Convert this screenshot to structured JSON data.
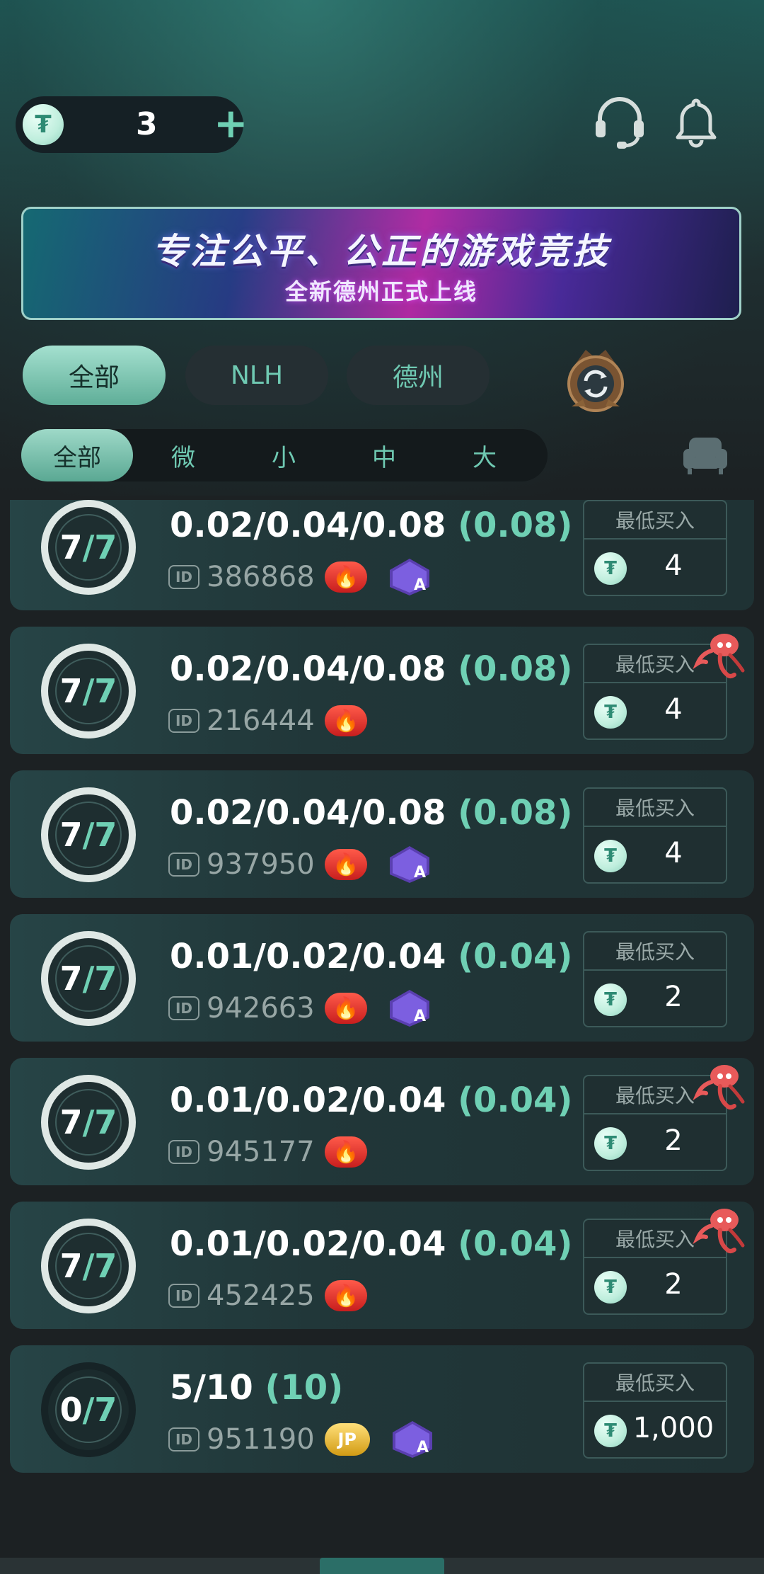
{
  "header": {
    "balance": "3",
    "currency_icon": "tether-coin-icon",
    "add_icon": "plus-icon",
    "support_icon": "headset-icon",
    "notify_icon": "bell-icon"
  },
  "banner": {
    "title": "专注公平、公正的游戏竞技",
    "subtitle": "全新德州正式上线"
  },
  "game_tabs": [
    {
      "label": "全部",
      "active": true
    },
    {
      "label": "NLH",
      "active": false
    },
    {
      "label": "德州",
      "active": false
    }
  ],
  "stake_tabs": [
    {
      "label": "全部",
      "active": true
    },
    {
      "label": "微",
      "active": false
    },
    {
      "label": "小",
      "active": false
    },
    {
      "label": "中",
      "active": false
    },
    {
      "label": "大",
      "active": false
    }
  ],
  "buyin_label": "最低买入",
  "id_label": "ID",
  "jp_label": "JP",
  "ai_label": "A",
  "tables": [
    {
      "seated": "7",
      "max": "/7",
      "blinds": "0.02/0.04/0.08",
      "ante": "(0.08)",
      "id": "386868",
      "fire": true,
      "ai": true,
      "jp": false,
      "squid": false,
      "min_buyin": "4"
    },
    {
      "seated": "7",
      "max": "/7",
      "blinds": "0.02/0.04/0.08",
      "ante": "(0.08)",
      "id": "216444",
      "fire": true,
      "ai": false,
      "jp": false,
      "squid": true,
      "min_buyin": "4"
    },
    {
      "seated": "7",
      "max": "/7",
      "blinds": "0.02/0.04/0.08",
      "ante": "(0.08)",
      "id": "937950",
      "fire": true,
      "ai": true,
      "jp": false,
      "squid": false,
      "min_buyin": "4"
    },
    {
      "seated": "7",
      "max": "/7",
      "blinds": "0.01/0.02/0.04",
      "ante": "(0.04)",
      "id": "942663",
      "fire": true,
      "ai": true,
      "jp": false,
      "squid": false,
      "min_buyin": "2"
    },
    {
      "seated": "7",
      "max": "/7",
      "blinds": "0.01/0.02/0.04",
      "ante": "(0.04)",
      "id": "945177",
      "fire": true,
      "ai": false,
      "jp": false,
      "squid": true,
      "min_buyin": "2"
    },
    {
      "seated": "7",
      "max": "/7",
      "blinds": "0.01/0.02/0.04",
      "ante": "(0.04)",
      "id": "452425",
      "fire": true,
      "ai": false,
      "jp": false,
      "squid": true,
      "min_buyin": "2"
    },
    {
      "seated": "0",
      "max": "/7",
      "blinds": "5/10",
      "ante": "(10)",
      "id": "951190",
      "fire": false,
      "ai": true,
      "jp": true,
      "squid": false,
      "min_buyin": "1,000"
    }
  ],
  "colors": {
    "accent": "#6fd0b4",
    "card": "#213739",
    "background": "#1c2123"
  }
}
